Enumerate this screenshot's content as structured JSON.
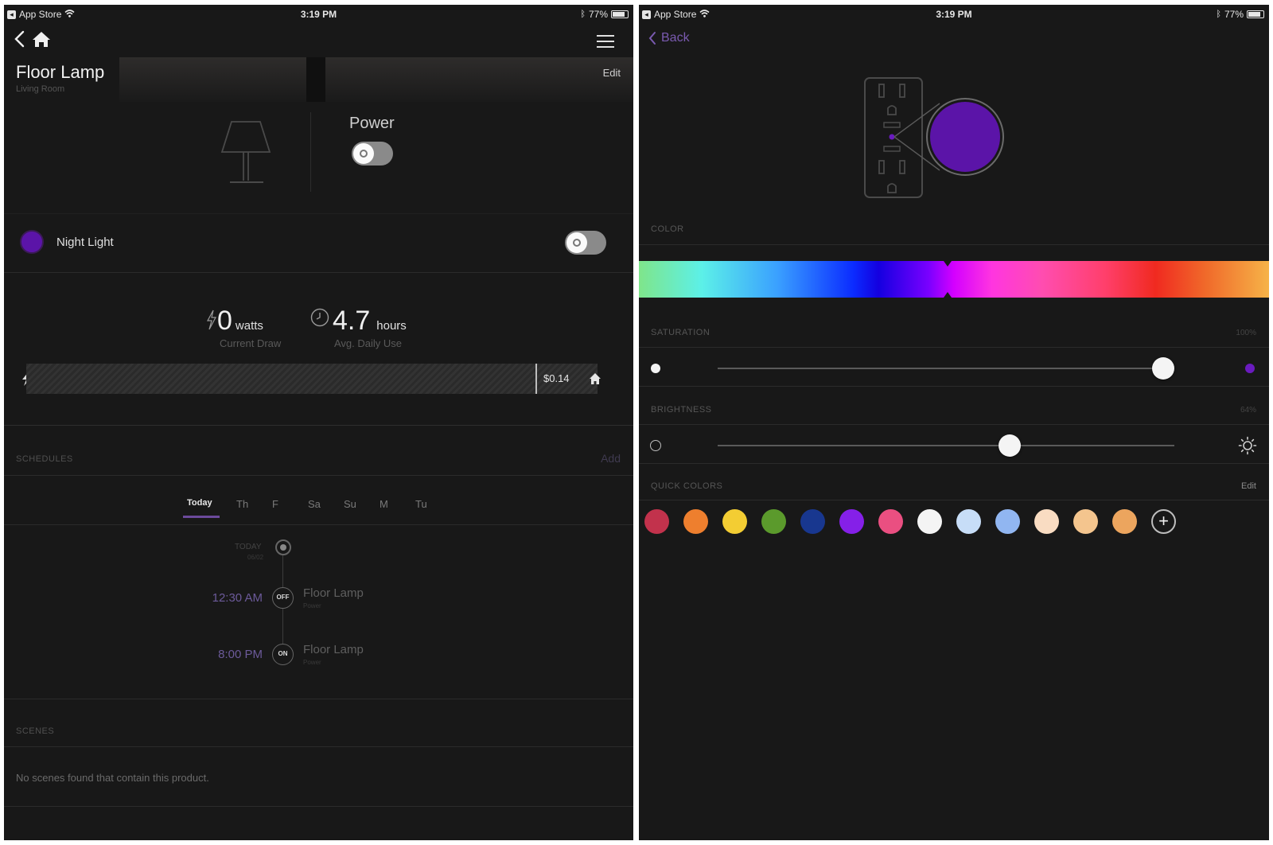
{
  "left": {
    "status": {
      "carrier": "App Store",
      "time": "3:19 PM",
      "battery": "77%"
    },
    "header": {
      "title": "Floor Lamp",
      "subtitle": "Living Room",
      "edit": "Edit"
    },
    "power": {
      "label": "Power",
      "on": false
    },
    "night_light": {
      "label": "Night Light",
      "color": "#5b14a8",
      "on": false
    },
    "energy": {
      "current_value": "0",
      "current_unit": "watts",
      "current_label": "Current Draw",
      "daily_value": "4.7",
      "daily_unit": "hours",
      "daily_label": "Avg. Daily Use",
      "cost": "$0.14"
    },
    "schedules": {
      "label": "SCHEDULES",
      "add": "Add",
      "days": [
        "Today",
        "Th",
        "F",
        "Sa",
        "Su",
        "M",
        "Tu"
      ],
      "today_label": "TODAY",
      "today_date": "06/02",
      "events": [
        {
          "time": "12:30 AM",
          "badge": "OFF",
          "name": "Floor Lamp",
          "sub": "Power"
        },
        {
          "time": "8:00 PM",
          "badge": "ON",
          "name": "Floor Lamp",
          "sub": "Power"
        }
      ]
    },
    "scenes": {
      "label": "SCENES",
      "empty": "No scenes found that contain this product."
    }
  },
  "right": {
    "status": {
      "carrier": "App Store",
      "time": "3:19 PM",
      "battery": "77%"
    },
    "back": "Back",
    "selected_color": "#5b14a8",
    "color_label": "COLOR",
    "saturation": {
      "label": "SATURATION",
      "value": "100%",
      "level": 1.0
    },
    "brightness": {
      "label": "BRIGHTNESS",
      "value": "64%",
      "level": 0.64
    },
    "quick_colors": {
      "label": "QUICK COLORS",
      "edit": "Edit",
      "swatches": [
        "#c2324c",
        "#ee7f2e",
        "#f3cd33",
        "#5b9a2c",
        "#18378f",
        "#8520e8",
        "#ea4f81",
        "#f4f4f4",
        "#c7ddf7",
        "#91b6f1",
        "#f9dcc2",
        "#f4c58e",
        "#eca55e"
      ]
    }
  }
}
